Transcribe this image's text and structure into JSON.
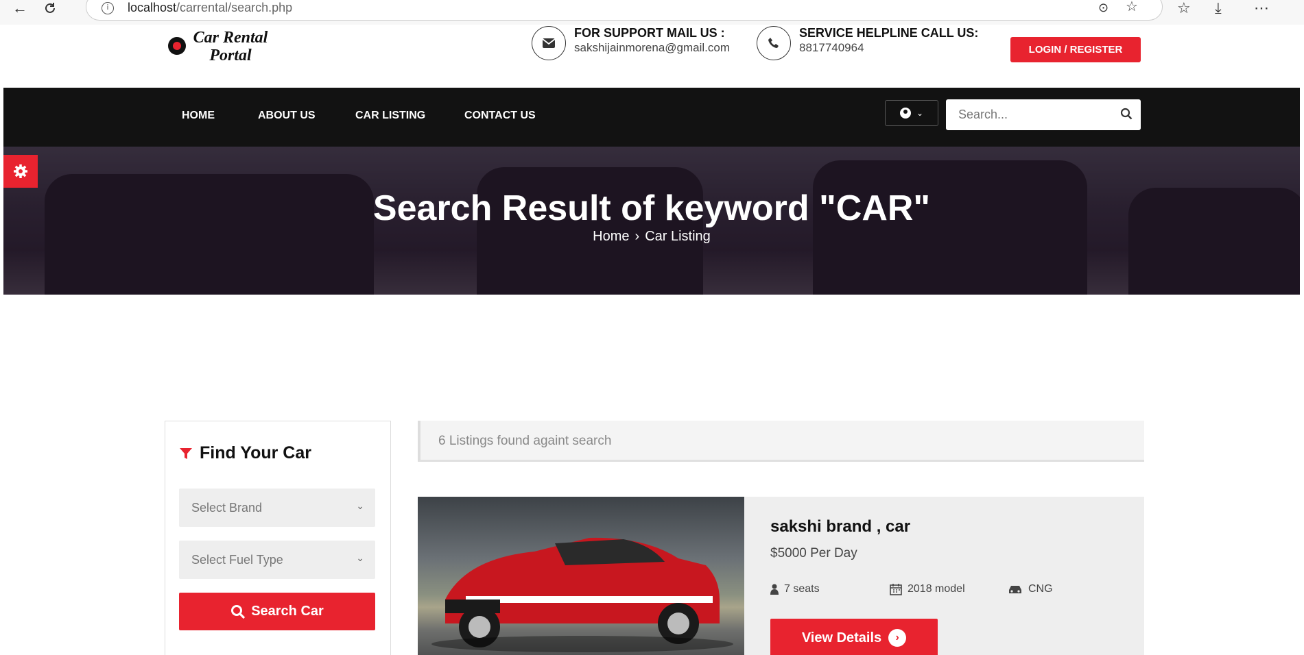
{
  "browser": {
    "url_host": "localhost",
    "url_path": "/carrental/search.php"
  },
  "header": {
    "logo_line1": "Car Rental",
    "logo_line2": "Portal",
    "support_title": "FOR SUPPORT MAIL US :",
    "support_email": "sakshijainmorena@gmail.com",
    "helpline_title": "SERVICE HELPLINE CALL US:",
    "helpline_phone": "8817740964",
    "login_label": "LOGIN / REGISTER"
  },
  "nav": {
    "items": [
      "HOME",
      "ABOUT US",
      "CAR LISTING",
      "CONTACT US"
    ],
    "search_placeholder": "Search..."
  },
  "hero": {
    "title": "Search Result of keyword \"CAR\"",
    "crumb_home": "Home",
    "crumb_current": "Car Listing"
  },
  "sidebar": {
    "title": "Find Your Car",
    "brand_placeholder": "Select Brand",
    "fuel_placeholder": "Select Fuel Type",
    "search_button": "Search Car"
  },
  "results": {
    "count_text": "6 Listings found againt search",
    "listings": [
      {
        "name": "sakshi brand , car",
        "price": "$5000 Per Day",
        "seats": "7 seats",
        "model": "2018 model",
        "fuel": "CNG",
        "button": "View Details"
      }
    ]
  },
  "colors": {
    "accent": "#e8232f",
    "nav_bg": "#121212"
  }
}
